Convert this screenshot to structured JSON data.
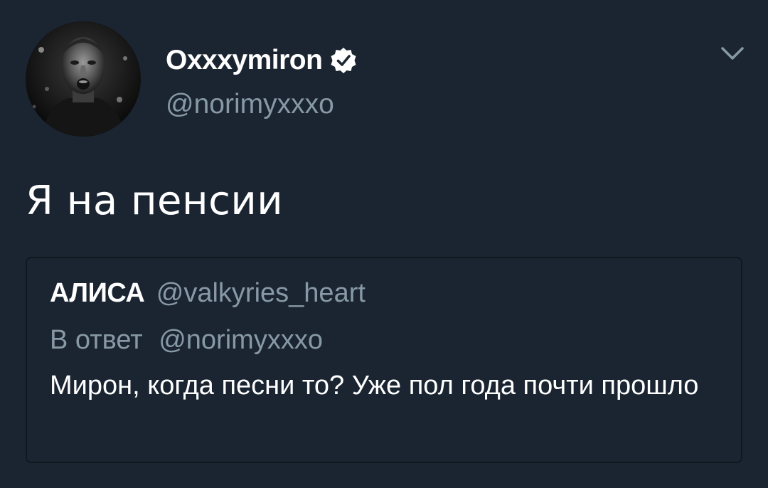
{
  "author": {
    "name": "Oxxxymiron",
    "handle": "@norimyxxxo",
    "verified": true,
    "avatar_icon": "avatar-portrait"
  },
  "tweet": {
    "text": "Я на пенсии"
  },
  "menu": {
    "icon": "chevron-down-icon"
  },
  "quote": {
    "name": "АЛИСА",
    "handle": "@valkyries_heart",
    "reply_prefix": "В ответ",
    "reply_handle": "@norimyxxxo",
    "text": "Мирон, когда песни то? Уже пол года почти прошло"
  },
  "colors": {
    "background": "#1b2532",
    "text_primary": "#ffffff",
    "text_secondary": "#8899a6",
    "card_border": "#10171e",
    "verified_badge": "#ffffff"
  }
}
